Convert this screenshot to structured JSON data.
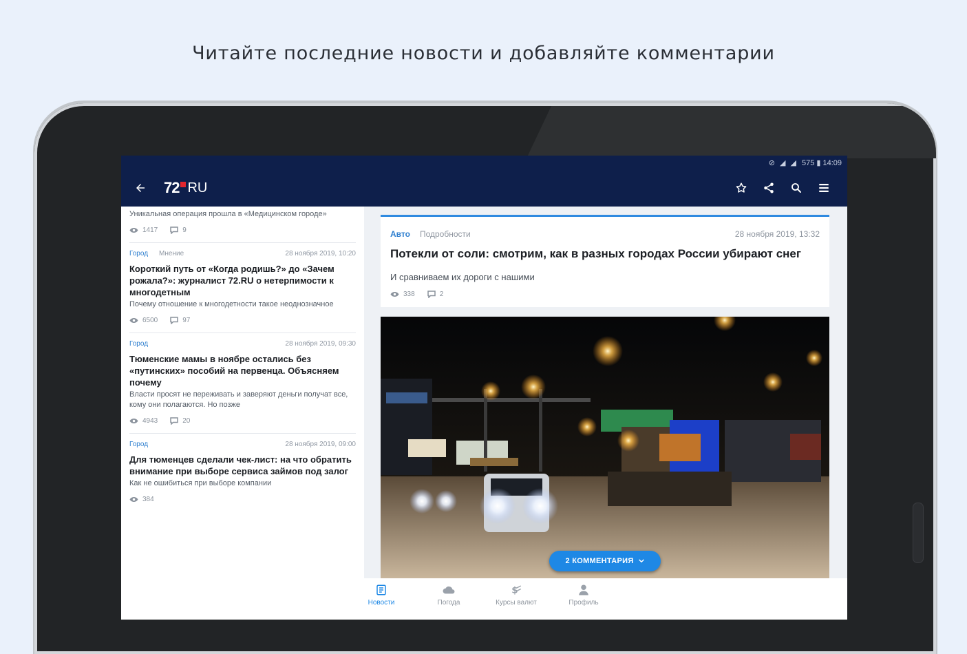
{
  "promo": {
    "text": "Читайте последние новости и добавляйте комментарии"
  },
  "statusbar": {
    "text": "575 ▮ 14:09"
  },
  "appbar": {
    "logo_number": "72",
    "logo_suffix": "RU",
    "actions": [
      "star-icon",
      "share-icon",
      "search-icon",
      "menu-icon"
    ]
  },
  "feed": {
    "items": [
      {
        "rubric": "",
        "tag": "",
        "date": "",
        "title": "",
        "subtitle": "Уникальная операция прошла в «Медицинском городе»",
        "views": "1417",
        "comments": "9"
      },
      {
        "rubric": "Город",
        "tag": "Мнение",
        "date": "28 ноября 2019, 10:20",
        "title": "Короткий путь от «Когда родишь?» до «Зачем рожала?»: журналист 72.RU о нетерпимости к многодетным",
        "subtitle": "Почему отношение к многодетности такое неоднозначное",
        "views": "6500",
        "comments": "97"
      },
      {
        "rubric": "Город",
        "tag": "",
        "date": "28 ноября 2019, 09:30",
        "title": "Тюменские мамы в ноябре остались без «путинских» пособий на первенца. Объясняем почему",
        "subtitle": "Власти просят не переживать и заверяют деньги получат все, кому они полагаются. Но позже",
        "views": "4943",
        "comments": "20"
      },
      {
        "rubric": "Город",
        "tag": "",
        "date": "28 ноября 2019, 09:00",
        "title": "Для тюменцев сделали чек-лист: на что обратить внимание при выборе сервиса займов под залог",
        "subtitle": "Как не ошибиться при выборе компании",
        "views": "384",
        "comments": ""
      }
    ]
  },
  "article": {
    "rubric": "Авто",
    "tag": "Подробности",
    "date": "28 ноября 2019, 13:32",
    "title": "Потекли от соли: смотрим, как в разных городах России убирают снег",
    "subtitle": "И сравниваем их дороги с нашими",
    "views": "338",
    "comments": "2",
    "comments_button": "2 КОММЕНТАРИЯ"
  },
  "bottom_nav": {
    "items": [
      {
        "label": "Новости",
        "icon": "news-icon",
        "active": true
      },
      {
        "label": "Погода",
        "icon": "weather-icon",
        "active": false
      },
      {
        "label": "Курсы валют",
        "icon": "currency-icon",
        "active": false
      },
      {
        "label": "Профиль",
        "icon": "profile-icon",
        "active": false
      }
    ]
  },
  "colors": {
    "appbar": "#0e1f4b",
    "accent": "#1e88e5",
    "logo_dot": "#e3262e",
    "page_bg": "#eaf1fb"
  }
}
